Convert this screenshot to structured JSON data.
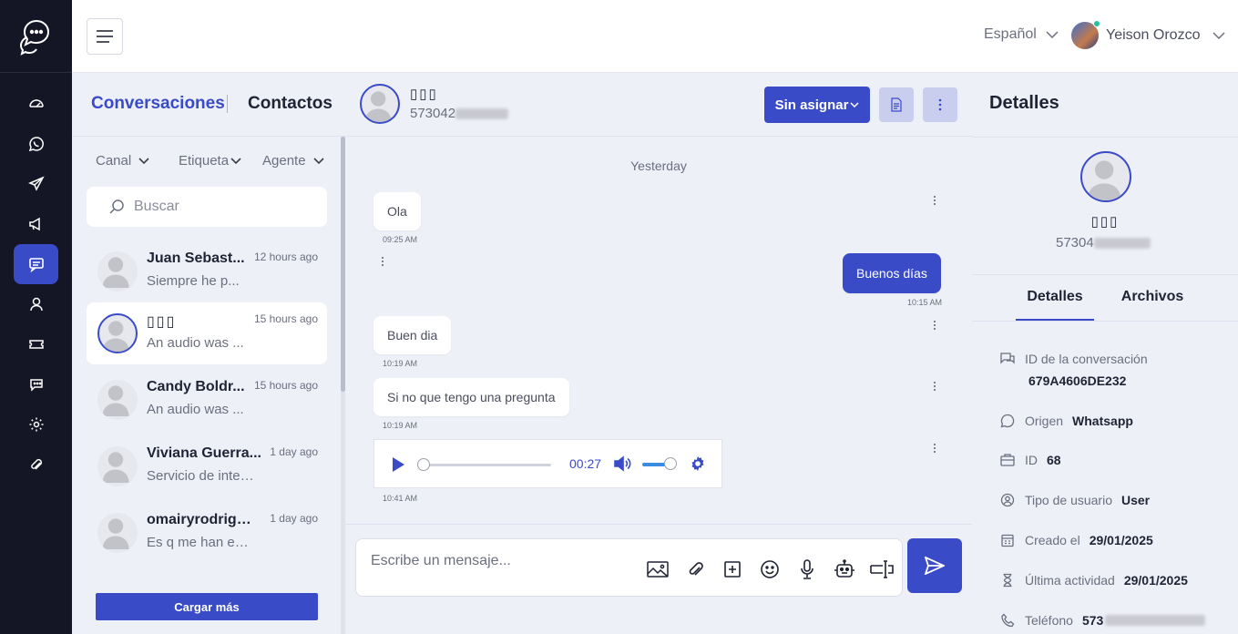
{
  "header": {
    "language": "Español",
    "user_name": "Yeison Orozco"
  },
  "list": {
    "tab_conversations": "Conversaciones",
    "tab_contacts": "Contactos",
    "filters": [
      "Canal",
      "Etiqueta",
      "Agente"
    ],
    "search_placeholder": "Buscar",
    "items": [
      {
        "name": "Juan Sebast...",
        "preview": "Siempre he p...",
        "time": "12 hours ago"
      },
      {
        "name": "▯▯▯",
        "preview": "An audio was ...",
        "time": "15 hours ago"
      },
      {
        "name": "Candy Boldr...",
        "preview": "An audio was ...",
        "time": "15 hours ago"
      },
      {
        "name": "Viviana Guerra...",
        "preview": "Servicio de inter...",
        "time": "1 day ago"
      },
      {
        "name": "omairyrodrigu...",
        "preview": "Es q me han est...",
        "time": "1 day ago"
      }
    ],
    "load_more": "Cargar más"
  },
  "chat": {
    "contact_name": "▯▯▯",
    "contact_phone": "573042",
    "assign_label": "Sin asignar",
    "day_separator": "Yesterday",
    "messages": [
      {
        "text": "Ola",
        "time": "09:25 AM",
        "dir": "in"
      },
      {
        "text": "Buenos días",
        "time": "10:15 AM",
        "dir": "out"
      },
      {
        "text": "Buen dia",
        "time": "10:19 AM",
        "dir": "in"
      },
      {
        "text": "Si no que tengo una pregunta",
        "time": "10:19 AM",
        "dir": "in"
      }
    ],
    "audio": {
      "duration": "00:27",
      "time": "10:41 AM"
    },
    "composer_placeholder": "Escribe un mensaje..."
  },
  "details": {
    "title": "Detalles",
    "contact_name": "▯▯▯",
    "contact_phone": "57304",
    "tab_details": "Detalles",
    "tab_files": "Archivos",
    "conversation_id_label": "ID de la conversación",
    "conversation_id": "679A4606DE232",
    "origin_label": "Origen",
    "origin": "Whatsapp",
    "id_label": "ID",
    "id": "68",
    "user_type_label": "Tipo de usuario",
    "user_type": "User",
    "created_label": "Creado el",
    "created": "29/01/2025",
    "last_activity_label": "Última actividad",
    "last_activity": "29/01/2025",
    "phone_label": "Teléfono",
    "phone": "573"
  }
}
